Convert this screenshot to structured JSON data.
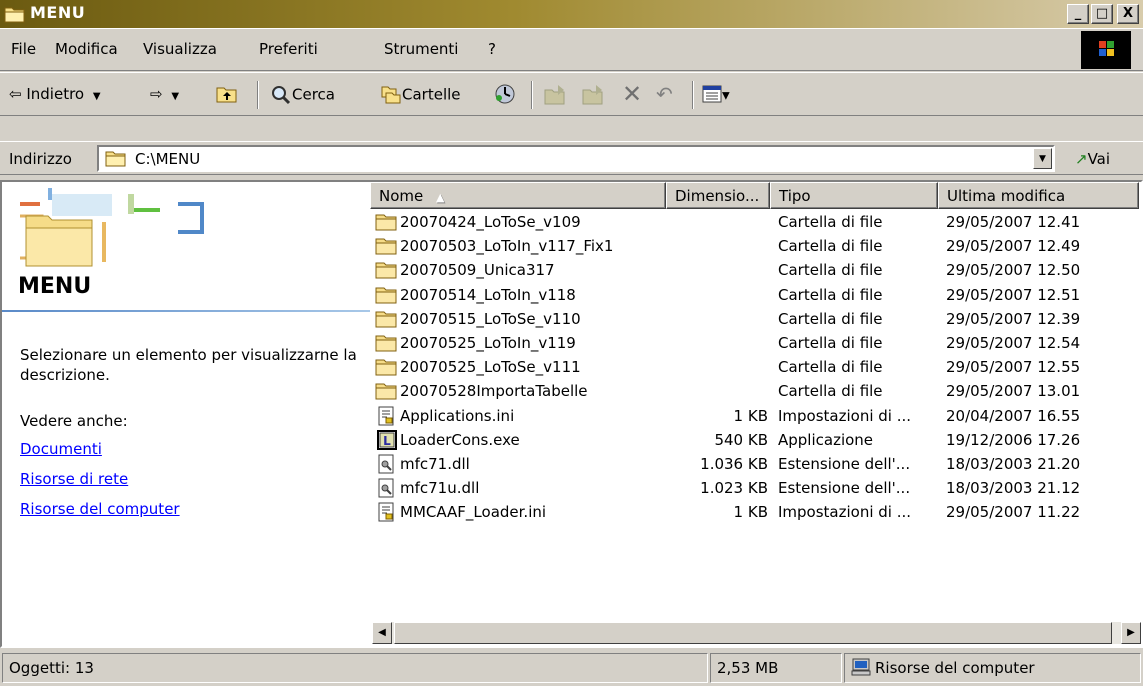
{
  "window": {
    "title": "MENU",
    "min_label": "_",
    "max_label": "□",
    "close_label": "X"
  },
  "menubar": {
    "items": [
      {
        "label": "File"
      },
      {
        "label": "Modifica"
      },
      {
        "label": "Visualizza"
      },
      {
        "label": "Preferiti"
      },
      {
        "label": "Strumenti"
      },
      {
        "label": "?"
      }
    ]
  },
  "toolbar": {
    "back_label": "Indietro",
    "search_label": "Cerca",
    "folders_label": "Cartelle"
  },
  "address": {
    "label": "Indirizzo",
    "value": "C:\\MENU",
    "go_label": "Vai"
  },
  "leftpane": {
    "title": "MENU",
    "description": "Selezionare un elemento per visualizzarne la descrizione.",
    "see_also": "Vedere anche:",
    "links": [
      {
        "label": "Documenti"
      },
      {
        "label": "Risorse di rete"
      },
      {
        "label": "Risorse del computer"
      }
    ]
  },
  "filelist": {
    "columns": [
      {
        "label": "Nome"
      },
      {
        "label": "Dimensio..."
      },
      {
        "label": "Tipo"
      },
      {
        "label": "Ultima modifica"
      }
    ],
    "rows": [
      {
        "name": "20070424_LoToSe_v109",
        "size": "",
        "type": "Cartella di file",
        "modified": "29/05/2007 12.41",
        "icon": "folder-icon"
      },
      {
        "name": "20070503_LoToIn_v117_Fix1",
        "size": "",
        "type": "Cartella di file",
        "modified": "29/05/2007 12.49",
        "icon": "folder-icon"
      },
      {
        "name": "20070509_Unica317",
        "size": "",
        "type": "Cartella di file",
        "modified": "29/05/2007 12.50",
        "icon": "folder-icon"
      },
      {
        "name": "20070514_LoToIn_v118",
        "size": "",
        "type": "Cartella di file",
        "modified": "29/05/2007 12.51",
        "icon": "folder-icon"
      },
      {
        "name": "20070515_LoToSe_v110",
        "size": "",
        "type": "Cartella di file",
        "modified": "29/05/2007 12.39",
        "icon": "folder-icon"
      },
      {
        "name": "20070525_LoToIn_v119",
        "size": "",
        "type": "Cartella di file",
        "modified": "29/05/2007 12.54",
        "icon": "folder-icon"
      },
      {
        "name": "20070525_LoToSe_v111",
        "size": "",
        "type": "Cartella di file",
        "modified": "29/05/2007 12.55",
        "icon": "folder-icon"
      },
      {
        "name": "20070528ImportaTabelle",
        "size": "",
        "type": "Cartella di file",
        "modified": "29/05/2007 13.01",
        "icon": "folder-icon"
      },
      {
        "name": "Applications.ini",
        "size": "1 KB",
        "type": "Impostazioni di ...",
        "modified": "20/04/2007 16.55",
        "icon": "ini-file-icon"
      },
      {
        "name": "LoaderCons.exe",
        "size": "540 KB",
        "type": "Applicazione",
        "modified": "19/12/2006 17.26",
        "icon": "exe-file-icon"
      },
      {
        "name": "mfc71.dll",
        "size": "1.036 KB",
        "type": "Estensione dell'...",
        "modified": "18/03/2003 21.20",
        "icon": "dll-file-icon"
      },
      {
        "name": "mfc71u.dll",
        "size": "1.023 KB",
        "type": "Estensione dell'...",
        "modified": "18/03/2003 21.12",
        "icon": "dll-file-icon"
      },
      {
        "name": "MMCAAF_Loader.ini",
        "size": "1 KB",
        "type": "Impostazioni di ...",
        "modified": "29/05/2007 11.22",
        "icon": "ini-file-icon"
      }
    ]
  },
  "statusbar": {
    "objects": "Oggetti: 13",
    "size": "2,53 MB",
    "zone": "Risorse del computer"
  },
  "colors": {
    "title_dark": "#6b5a10",
    "title_light": "#d8ccac",
    "face": "#d4d0c8",
    "link": "#0000ff"
  }
}
